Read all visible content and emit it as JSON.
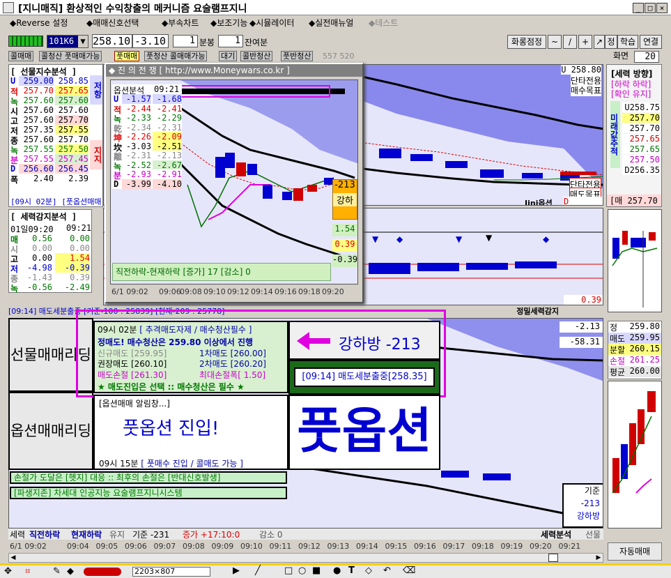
{
  "window": {
    "title": "[지니매직] 환상적인 수익창출의 메커니즘 요술램프지니",
    "buttons": [
      "_",
      "□",
      "×"
    ]
  },
  "menu": {
    "items": [
      "◆Reverse 설정",
      "◆매매신호선택",
      "◆부속차트",
      "◆보조기능",
      "◆시뮬레이터",
      "◆실전매뉴얼",
      "◆테스트"
    ]
  },
  "toolbar": {
    "code": "101K6",
    "price": "258.10",
    "change": "-3.10",
    "interval_value": "1",
    "interval_unit": "분봉",
    "remain_value": "1",
    "remain_unit": "잔여분",
    "right_buttons": [
      "화롱점정",
      "~",
      "/",
      "+",
      "↗",
      "정",
      "학습",
      "연결"
    ],
    "screen_label": "화면",
    "screen_value": "20"
  },
  "tabs": {
    "items": [
      "콜매매",
      "콜청산 풋매매가능",
      "풋매매",
      "풋청산 콜매매가능",
      "대기",
      "콜반청산",
      "풋반청산"
    ],
    "counts": "557 520"
  },
  "futures_panel": {
    "title": "[ 선물지수분석 ]",
    "side": "저항",
    "side2": "지지",
    "rows": [
      {
        "k": "U",
        "v1": "259.00",
        "v2": "258.85"
      },
      {
        "k": "적",
        "v1": "257.70",
        "v2": "257.65"
      },
      {
        "k": "녹",
        "v1": "257.60",
        "v2": "257.60"
      },
      {
        "k": "시",
        "v1": "257.60",
        "v2": "257.60"
      },
      {
        "k": "고",
        "v1": "257.60",
        "v2": "257.70"
      },
      {
        "k": "저",
        "v1": "257.35",
        "v2": "257.55"
      },
      {
        "k": "종",
        "v1": "257.60",
        "v2": "257.70"
      },
      {
        "k": "녹",
        "v1": "257.55",
        "v2": "257.50"
      },
      {
        "k": "분",
        "v1": "257.55",
        "v2": "257.45"
      },
      {
        "k": "D",
        "v1": "256.60",
        "v2": "256.45"
      },
      {
        "k": "폭",
        "v1": "2.40",
        "v2": "2.39"
      }
    ],
    "footer": "[09시 02분] [풋옵션매매"
  },
  "force_panel": {
    "title": "[ 세력감지분석 ]",
    "date": "01일09:20",
    "time": "09:21",
    "rows": [
      {
        "k": "매",
        "v1": "0.56",
        "v2": "0.00"
      },
      {
        "k": "시",
        "v1": "0.00",
        "v2": "0.00"
      },
      {
        "k": "고",
        "v1": "0.00",
        "v2": "1.54"
      },
      {
        "k": "저",
        "v1": "-4.98",
        "v2": "-0.39"
      },
      {
        "k": "종",
        "v1": "-1.43",
        "v2": "0.39"
      },
      {
        "k": "녹",
        "v1": "-0.56",
        "v2": "-2.49"
      }
    ]
  },
  "popup": {
    "title": "◆ 진 의 전 쟁 [ http://www.Moneywars.co.kr ]",
    "option_title": "옵션분석",
    "option_time": "09:21",
    "rows": [
      {
        "k": "U",
        "v1": "-1.57",
        "v2": "-1.68"
      },
      {
        "k": "적",
        "v1": "-2.44",
        "v2": "-2.41"
      },
      {
        "k": "녹",
        "v1": "-2.33",
        "v2": "-2.29"
      },
      {
        "k": "乾",
        "v1": "-2.34",
        "v2": "-2.31"
      },
      {
        "k": "坤",
        "v1": "-2.26",
        "v2": "-2.09"
      },
      {
        "k": "坎",
        "v1": "-3.03",
        "v2": "-2.51"
      },
      {
        "k": "離",
        "v1": "-2.31",
        "v2": "-2.13"
      },
      {
        "k": "녹",
        "v1": "-2.52",
        "v2": "-2.67"
      },
      {
        "k": "분",
        "v1": "-2.93",
        "v2": "-2.91"
      },
      {
        "k": "D",
        "v1": "-3.99",
        "v2": "-4.10"
      }
    ],
    "side_value": "-213",
    "side_label": "강하",
    "side_vals": [
      "1.54",
      "0.39",
      "-0.39"
    ],
    "status": "직전하락-현재하락 [증가]  17 [감소]  0",
    "times": [
      "6/1 09:02",
      "09:06",
      "09:08",
      "09:10",
      "09:12",
      "09:14",
      "09:16",
      "09:18",
      "09:20"
    ]
  },
  "main_chart": {
    "top_right": [
      "U 258.80",
      "단타전용",
      "매수목표"
    ],
    "bottom_right": [
      "단타전용",
      "매도목표"
    ],
    "jini_label": "Jini옵션",
    "jini_value": "D 256.50",
    "force_line_value": "0.39",
    "band_label": "[09:14] 매도세분출중 [기준-100 : 25839] [현재-209 : 25778]",
    "band_right": "정밀세력감지"
  },
  "force_direction": {
    "title": "[세력 방향]",
    "sub1": "[하락 하락]",
    "sub2": "[확인 유지]",
    "vertical": "미래값추적",
    "values": [
      {
        "text": "U258.75",
        "color": "#000"
      },
      {
        "text": "257.70",
        "color": "#000"
      },
      {
        "text": "257.70",
        "color": "#000"
      },
      {
        "text": "257.65",
        "color": "#d00000"
      },
      {
        "text": "257.65",
        "color": "#007000"
      },
      {
        "text": "257.50",
        "color": "#c000c0"
      },
      {
        "text": "D256.35",
        "color": "#000"
      }
    ],
    "bottom_label": "[매",
    "bottom_value": "257.70"
  },
  "trade_box": {
    "futures_label": "선물매매리딩",
    "options_label": "옵션매매리딩",
    "time1": "09시 02분",
    "header1": "[ 추격매도자제 / 매수청산필수 ]",
    "line1": "정매도! 매수청산은 259.80 이상에서 진행",
    "new_sell": "신규매도 [259.95]",
    "sell1": "1차매도 [260.00]",
    "rec_sell": "권장매도 [260.10]",
    "sell2": "2차매도 [260.20]",
    "stop": "매도손절 [261.30]",
    "max_stop": "최대손절폭[ 1.50]",
    "notice": "★ 매도진입은 선택  ::  매수청산은 필수 ★",
    "arrow_text": "강하방 -213",
    "signal": "[09:14] 매도세분출중[258.35]",
    "option_alert": "[옵션매매 알림창...]",
    "option_entry": "풋옵션 진입!",
    "big_text": "풋옵션",
    "time2": "09시 15분",
    "header2": "[ 풋매수 진입 /  콜매도 가능 ]",
    "msg1": "손절가 도달은 [헷지] 대응 :: 최후의 손절은 [반대신호발생]",
    "msg2": "[파생지존] 차세대 인공지능 요술램프지니시스템"
  },
  "lower_chart": {
    "values": [
      "-2.13",
      "-58.31"
    ],
    "base_label": "기준",
    "base_value": "-213",
    "base_sub": "강하방"
  },
  "lower_right_panel": {
    "rows": [
      {
        "k": "정",
        "v": "259.80",
        "color": "#000"
      },
      {
        "k": "매도",
        "v": "259.95",
        "color": "#000"
      },
      {
        "k": "분할",
        "v": "260.15",
        "color": "#000"
      },
      {
        "k": "손절",
        "v": "261.25",
        "color": "#c000c0"
      },
      {
        "k": "평균",
        "v": "260.00",
        "color": "#000"
      }
    ],
    "auto_trade": "자동매매"
  },
  "status_bar": {
    "items": [
      "세력",
      "직전하락",
      "현재하락",
      "유지",
      "기준 -231",
      "증가 +17:10:0",
      "감소 0"
    ],
    "right": [
      "세력분석",
      "선물"
    ]
  },
  "time_axis": [
    "6/1 09:02",
    "09:04",
    "09:05",
    "09:06",
    "09:07",
    "09:08",
    "09:09",
    "09:10",
    "09:11",
    "09:12",
    "09:13",
    "09:14",
    "09:15",
    "09:16",
    "09:17",
    "09:18",
    "09:19",
    "09:20",
    "09:21"
  ],
  "taskbar": {
    "size": "2203×807"
  }
}
